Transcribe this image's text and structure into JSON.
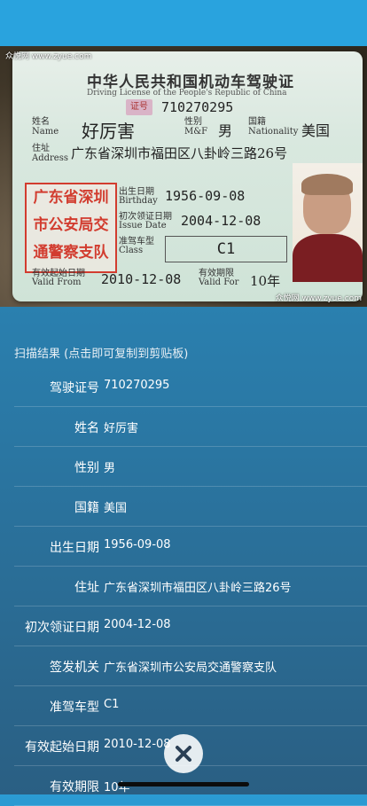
{
  "license_image": {
    "title": "中华人民共和国机动车驾驶证",
    "subtitle": "Driving License of the People's Republic of China",
    "seal_small": "证号",
    "id_number": "710270295",
    "name_label": "姓名\nName",
    "name": "好厉害",
    "sex_label": "性别\nM&F",
    "sex": "男",
    "nationality_label": "国籍\nNationality",
    "nationality": "美国",
    "address_label": "住址\nAddress",
    "address": "广东省深圳市福田区八卦岭三路26号",
    "birth_label": "出生日期\nBirthday",
    "birth": "1956-09-08",
    "issue_label": "初次领证日期\nIssue Date",
    "issue": "2004-12-08",
    "class_label": "准驾车型\nClass",
    "class": "C1",
    "valid_from_label": "有效起始日期\nValid From",
    "valid_from": "2010-12-08",
    "valid_for_label": "有效期限\nValid For",
    "valid_for": "10年",
    "stamp": [
      "广东省深圳",
      "市公安局交",
      "通警察支队"
    ],
    "watermark_top": "众悦网 www.zyue.com",
    "watermark_bottom": "众悦网 www.zyue.com"
  },
  "results": {
    "header": "扫描结果 (点击即可复制到剪贴板)",
    "rows": [
      {
        "label": "驾驶证号",
        "value": "710270295"
      },
      {
        "label": "姓名",
        "value": "好厉害"
      },
      {
        "label": "性别",
        "value": "男"
      },
      {
        "label": "国籍",
        "value": "美国"
      },
      {
        "label": "出生日期",
        "value": "1956-09-08"
      },
      {
        "label": "住址",
        "value": "广东省深圳市福田区八卦岭三路26号"
      },
      {
        "label": "初次领证日期",
        "value": "2004-12-08"
      },
      {
        "label": "签发机关",
        "value": "广东省深圳市公安局交通警察支队"
      },
      {
        "label": "准驾车型",
        "value": "C1"
      },
      {
        "label": "有效起始日期",
        "value": "2010-12-08"
      },
      {
        "label": "有效期限",
        "value": "10年"
      }
    ]
  },
  "close_icon": "close-icon",
  "colors": {
    "status_bar": "#29a3de",
    "background_top": "#2b9bd3",
    "background_bottom": "#2a5f83",
    "stamp_red": "#d23c2f"
  }
}
